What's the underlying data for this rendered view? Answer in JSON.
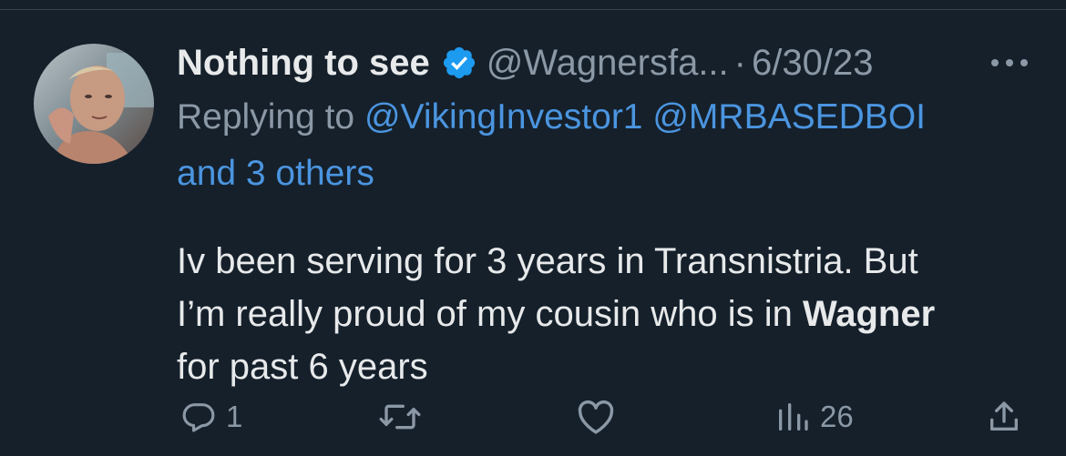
{
  "tweet": {
    "author_name": "Nothing to see",
    "handle": "@Wagnersfa...",
    "separator": "·",
    "date": "6/30/23",
    "replying_prefix": "Replying to",
    "replying_mentions": [
      "@VikingInvestor1",
      "@MRBASEDBOI"
    ],
    "replying_others": "and 3 others",
    "text_line1": "Iv been serving for 3 years in Transnistria. But",
    "text_line2_prefix": "I’m really proud of my cousin who is in ",
    "text_line2_bold": "Wagner",
    "text_line3": "for past 6 years"
  },
  "actions": {
    "reply_count": "1",
    "retweet_count": "",
    "like_count": "",
    "views_count": "26"
  },
  "icons": {
    "verified": "verified-badge-icon",
    "more": "more-horizontal-icon",
    "reply": "reply-icon",
    "retweet": "retweet-icon",
    "like": "heart-icon",
    "views": "views-icon",
    "share": "share-icon"
  },
  "colors": {
    "background": "#15202b",
    "primary_text": "#e7e9ea",
    "secondary_text": "#8b98a5",
    "accent": "#4b95e0",
    "verified": "#1d9bf0"
  }
}
